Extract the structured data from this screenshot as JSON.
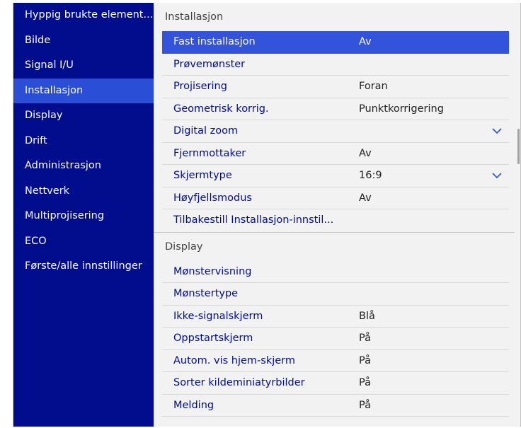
{
  "sidebar": {
    "items": [
      {
        "label": "Hyppig brukte element...",
        "active": false
      },
      {
        "label": "Bilde",
        "active": false
      },
      {
        "label": "Signal I/U",
        "active": false
      },
      {
        "label": "Installasjon",
        "active": true
      },
      {
        "label": "Display",
        "active": false
      },
      {
        "label": "Drift",
        "active": false
      },
      {
        "label": "Administrasjon",
        "active": false
      },
      {
        "label": "Nettverk",
        "active": false
      },
      {
        "label": "Multiprojisering",
        "active": false
      },
      {
        "label": "ECO",
        "active": false
      },
      {
        "label": "Første/alle innstillinger",
        "active": false
      }
    ]
  },
  "panel": {
    "installasjon": {
      "title": "Installasjon",
      "rows": [
        {
          "label": "Fast installasjon",
          "value": "Av"
        },
        {
          "label": "Prøvemønster",
          "value": ""
        },
        {
          "label": "Projisering",
          "value": "Foran"
        },
        {
          "label": "Geometrisk korrig.",
          "value": "Punktkorrigering"
        },
        {
          "label": "Digital zoom",
          "value": ""
        },
        {
          "label": "Fjernmottaker",
          "value": "Av"
        },
        {
          "label": "Skjermtype",
          "value": "16:9"
        },
        {
          "label": "Høyfjellsmodus",
          "value": "Av"
        },
        {
          "label": "Tilbakestill Installasjon-innstil...",
          "value": ""
        }
      ]
    },
    "display": {
      "title": "Display",
      "rows": [
        {
          "label": "Mønstervisning",
          "value": ""
        },
        {
          "label": "Mønstertype",
          "value": ""
        },
        {
          "label": "Ikke-signalskjerm",
          "value": "Blå"
        },
        {
          "label": "Oppstartskjerm",
          "value": "På"
        },
        {
          "label": "Autom. vis hjem-skjerm",
          "value": "På"
        },
        {
          "label": "Sorter kildeminiatyrbilder",
          "value": "På"
        },
        {
          "label": "Melding",
          "value": "På"
        }
      ]
    }
  },
  "icons": {
    "expand": "chevron-down-icon"
  },
  "colors": {
    "sidebar_bg": "#020d8e",
    "sidebar_active": "#2a4ed6",
    "row_selected": "#3353db",
    "text_primary": "#020d8e"
  }
}
